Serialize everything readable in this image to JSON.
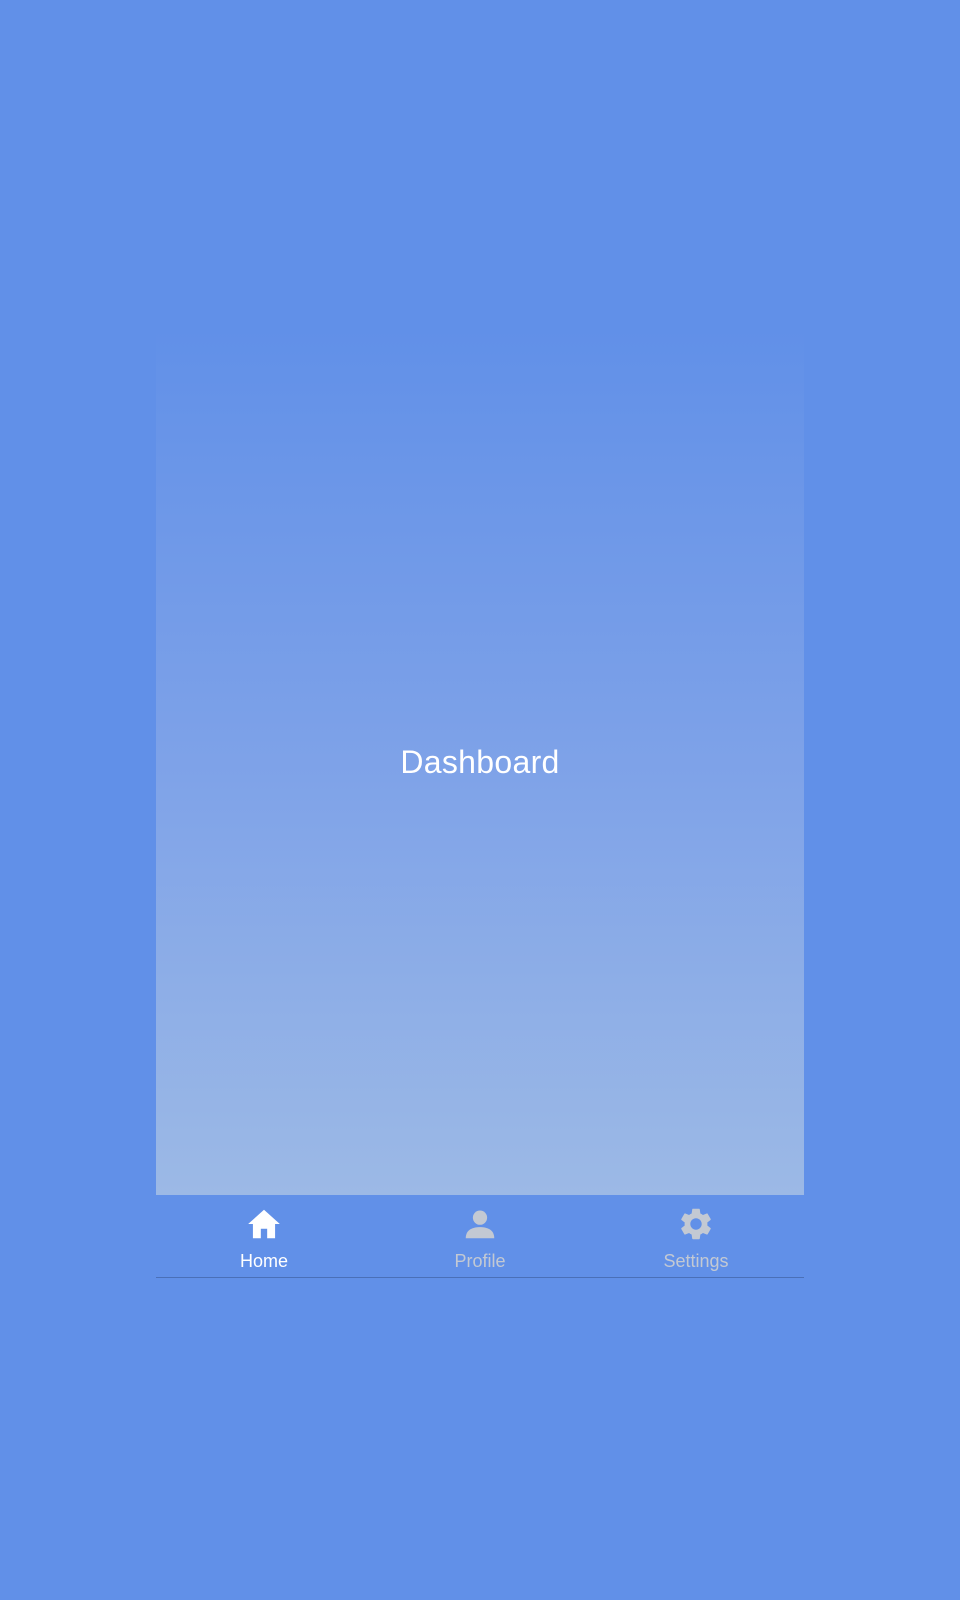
{
  "screen": {
    "title": "Dashboard"
  },
  "tab_bar": {
    "items": [
      {
        "label": "Home",
        "icon": "home-icon",
        "active": true
      },
      {
        "label": "Profile",
        "icon": "person-icon",
        "active": false
      },
      {
        "label": "Settings",
        "icon": "gear-icon",
        "active": false
      }
    ]
  },
  "colors": {
    "background": "#6190e8",
    "active_tab": "#ffffff",
    "inactive_tab": "#c3c9d3"
  }
}
